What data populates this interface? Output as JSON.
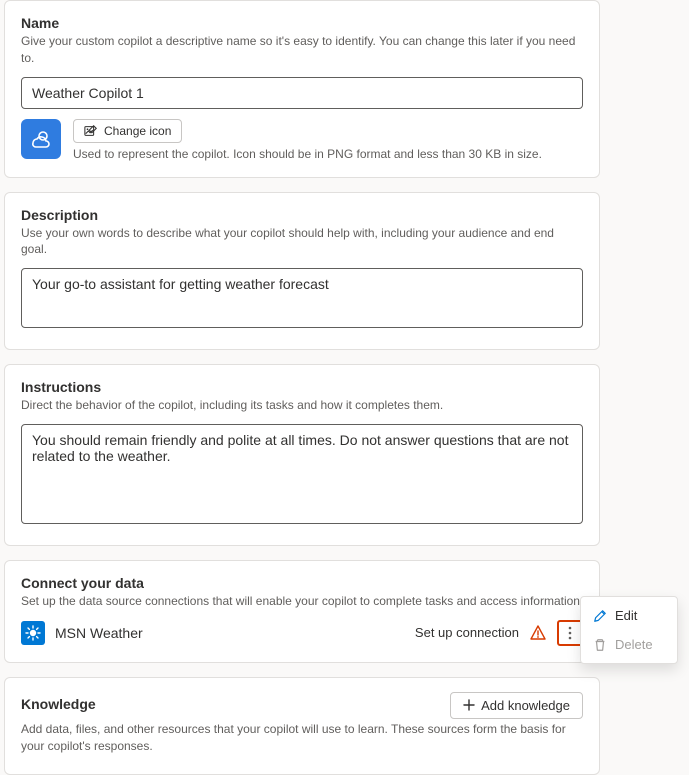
{
  "name": {
    "title": "Name",
    "desc": "Give your custom copilot a descriptive name so it's easy to identify. You can change this later if you need to.",
    "value": "Weather Copilot 1",
    "change_icon_label": "Change icon",
    "icon_hint": "Used to represent the copilot. Icon should be in PNG format and less than 30 KB in size."
  },
  "description": {
    "title": "Description",
    "desc": "Use your own words to describe what your copilot should help with, including your audience and end goal.",
    "value": "Your go-to assistant for getting weather forecast"
  },
  "instructions": {
    "title": "Instructions",
    "desc": "Direct the behavior of the copilot, including its tasks and how it completes them.",
    "value": "You should remain friendly and polite at all times. Do not answer questions that are not related to the weather."
  },
  "connect": {
    "title": "Connect your data",
    "desc": "Set up the data source connections that will enable your copilot to complete tasks and access information",
    "source_name": "MSN Weather",
    "setup_label": "Set up connection"
  },
  "knowledge": {
    "title": "Knowledge",
    "add_label": "Add knowledge",
    "desc": "Add data, files, and other resources that your copilot will use to learn. These sources form the basis for your copilot's responses."
  },
  "menu": {
    "edit": "Edit",
    "delete": "Delete"
  },
  "colors": {
    "primary": "#0078d4",
    "icon_bg": "#2f7ce0",
    "warn": "#d83b01",
    "red": "#e81123"
  }
}
